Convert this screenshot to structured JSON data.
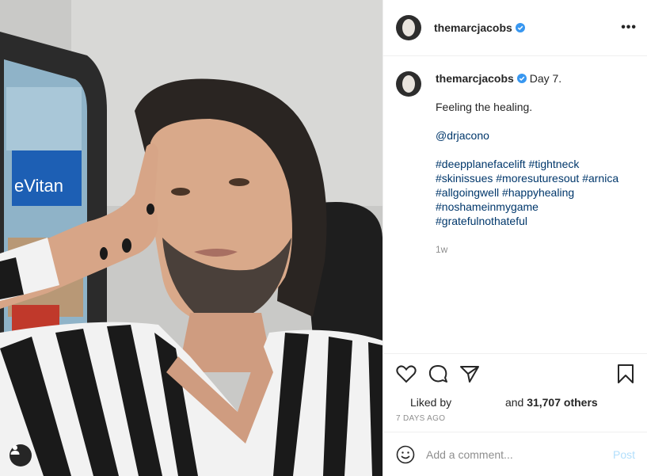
{
  "post": {
    "username": "themarcjacobs",
    "more_label": "•••"
  },
  "caption": {
    "username": "themarcjacobs",
    "first_line": "Day 7.",
    "line2": "Feeling the healing.",
    "mention": "@drjacono",
    "hashtags": [
      "#deepplanefacelift #tightneck",
      "#skinissues #moresuturesout #arnica",
      "#allgoingwell #happyhealing",
      "#noshameinmygame",
      "#gratefulnothateful"
    ],
    "time_ago": "1w"
  },
  "likes": {
    "prefix": "Liked by",
    "suffix": "and",
    "count": "31,707 others"
  },
  "date": "7 DAYS AGO",
  "comment": {
    "placeholder": "Add a comment...",
    "post_label": "Post"
  },
  "photo": {
    "sign_text": "eVitan"
  },
  "colors": {
    "verified": "#3897f0",
    "link": "#00376b",
    "post_button": "#b2dffc"
  },
  "icons": [
    "heart-icon",
    "comment-icon",
    "share-icon",
    "bookmark-icon",
    "emoji-icon",
    "user-tag-icon",
    "verified-icon"
  ]
}
